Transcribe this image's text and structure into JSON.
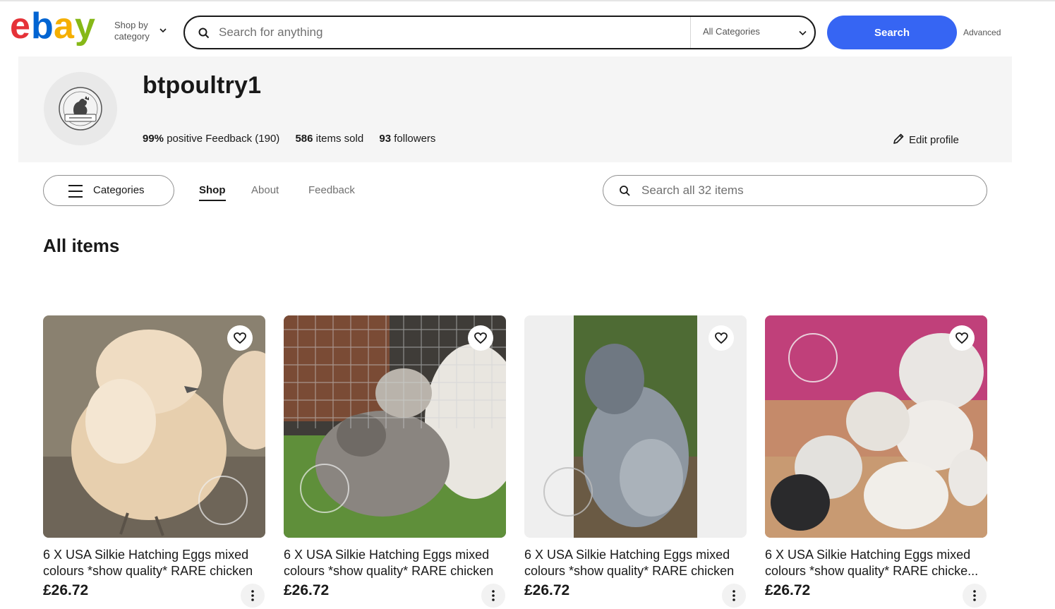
{
  "header": {
    "logo_letters": [
      "e",
      "b",
      "a",
      "y"
    ],
    "logo_colors": [
      "#e53238",
      "#0064d2",
      "#f5af02",
      "#86b817"
    ],
    "shop_by_line1": "Shop by",
    "shop_by_line2": "category",
    "search_placeholder": "Search for anything",
    "category_select": "All Categories",
    "search_button": "Search",
    "advanced_link": "Advanced",
    "accent_color": "#3665f3"
  },
  "seller": {
    "name": "btpoultry1",
    "feedback_percent": "99%",
    "feedback_text": "positive Feedback (190)",
    "items_sold_count": "586",
    "items_sold_text": "items sold",
    "followers_count": "93",
    "followers_text": "followers",
    "edit_profile": "Edit profile"
  },
  "nav": {
    "categories_button": "Categories",
    "tabs": [
      {
        "label": "Shop",
        "active": true
      },
      {
        "label": "About",
        "active": false
      },
      {
        "label": "Feedback",
        "active": false
      }
    ],
    "store_search_placeholder": "Search all 32 items"
  },
  "section_title": "All items",
  "items": [
    {
      "title_line1": "6 X USA Silkie Hatching Eggs mixed",
      "title_line2": "colours *show quality* RARE chicken",
      "price": "£26.72",
      "image": "buff-silkie-photo"
    },
    {
      "title_line1": "6 X USA Silkie Hatching Eggs mixed",
      "title_line2": "colours *show quality* RARE chicken",
      "price": "£26.72",
      "image": "grey-silkie-on-grass-photo"
    },
    {
      "title_line1": "6 X USA Silkie Hatching Eggs mixed",
      "title_line2": "colours *show quality* RARE chicken",
      "price": "£26.72",
      "image": "splash-silkie-photo"
    },
    {
      "title_line1": "6 X USA Silkie Hatching Eggs mixed",
      "title_line2": "colours *show quality* RARE chicke...",
      "price": "£26.72",
      "image": "silkie-chicks-photo"
    }
  ]
}
